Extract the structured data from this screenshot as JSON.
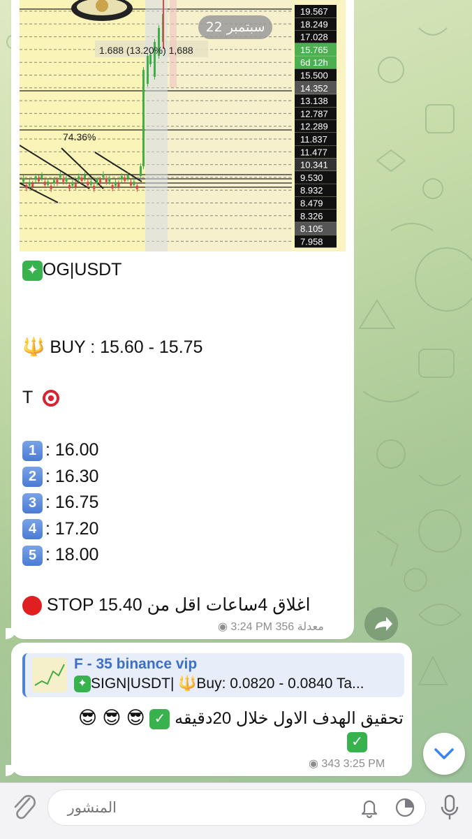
{
  "chart": {
    "date_pill": "22 سبتمبر",
    "measure_label": "1.688 (13.20%) 1,688",
    "pct_label": "74.36%",
    "price_levels": [
      "19.567",
      "18.249",
      "17.028",
      "15.765",
      "6d 12h",
      "15.500",
      "14.352",
      "13.138",
      "12.787",
      "12.289",
      "11.837",
      "11.477",
      "10.341",
      "9.530",
      "8.932",
      "8.479",
      "8.326",
      "8.105",
      "7.958"
    ]
  },
  "message1": {
    "pair": "OG|USDT",
    "buy_line": "BUY  : 15.60 - 15.75",
    "targets_label": "T",
    "targets": [
      {
        "num": "1",
        "value": ": 16.00"
      },
      {
        "num": "2",
        "value": ": 16.30"
      },
      {
        "num": "3",
        "value": ": 16.75"
      },
      {
        "num": "4",
        "value": ": 17.20"
      },
      {
        "num": "5",
        "value": ": 18.00"
      }
    ],
    "stop_line": "STOP  15.40 اغلاق 4ساعات اقل من",
    "views": "356",
    "edited": "معدلة",
    "time": "3:24 PM"
  },
  "message2": {
    "reply_title": "F - 35 binance vip",
    "reply_text": "SIGN|USDT| 🔱Buy: 0.0820 - 0.0840 Ta...",
    "text": "تحقيق الهدف الاول خلال 20دقيقه",
    "views": "343",
    "time": "3:25 PM"
  },
  "composer": {
    "placeholder": "المنشور"
  },
  "icons": {
    "attach": "paperclip-icon",
    "bell": "bell-icon",
    "timer": "timer-icon",
    "mic": "microphone-icon",
    "forward": "share-forward-icon",
    "scroll": "chevron-down-icon",
    "eye": "eye-icon"
  }
}
